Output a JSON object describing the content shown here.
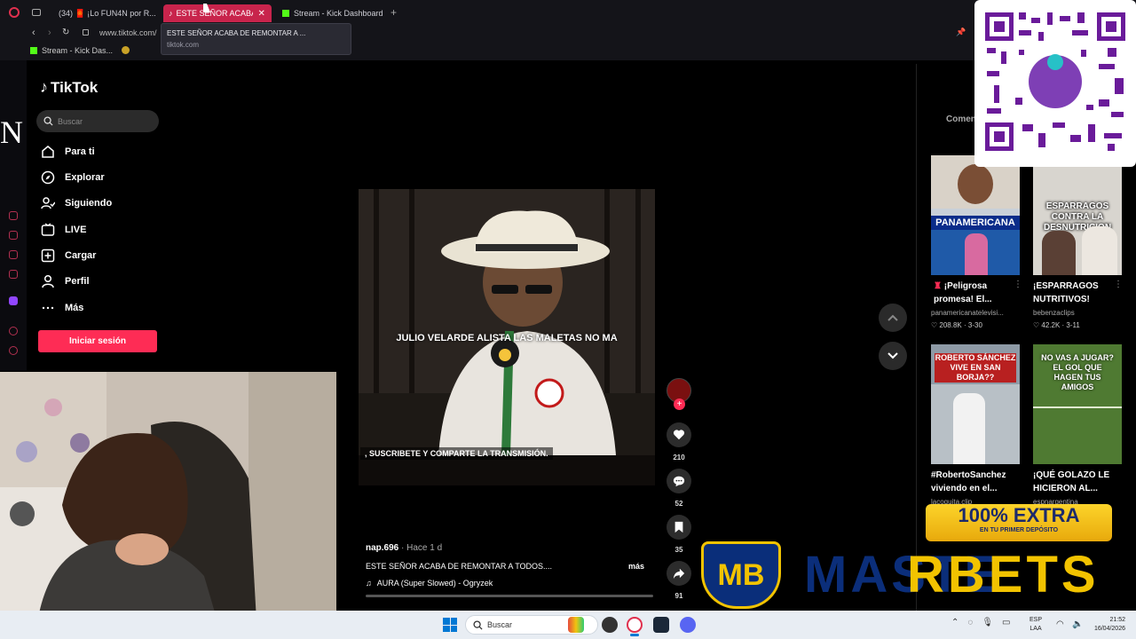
{
  "browser": {
    "tabs": [
      {
        "label": "(34) 🧧 ¡Lo FUN4N por R...",
        "active": false
      },
      {
        "label": "ESTE SEÑOR ACABA DE",
        "active": true
      },
      {
        "label": "Stream - Kick Dashboard",
        "active": false
      }
    ],
    "url": "www.tiktok.com/",
    "tooltip_title": "ESTE SEÑOR ACABA DE REMONTAR A ...",
    "tooltip_domain": "tiktok.com",
    "bookmark": "Stream - Kick Das..."
  },
  "tiktok": {
    "logo": "TikTok",
    "search_placeholder": "Buscar",
    "nav": [
      {
        "label": "Para ti",
        "icon": "home-icon"
      },
      {
        "label": "Explorar",
        "icon": "compass-icon"
      },
      {
        "label": "Siguiendo",
        "icon": "following-icon"
      },
      {
        "label": "LIVE",
        "icon": "live-icon"
      },
      {
        "label": "Cargar",
        "icon": "upload-icon"
      },
      {
        "label": "Perfil",
        "icon": "profile-icon"
      },
      {
        "label": "Más",
        "icon": "more-icon"
      }
    ],
    "login_button": "Iniciar sesión",
    "big_letter": "N"
  },
  "video": {
    "overlay_title": "JULIO VELARDE ALISTA LAS MALETAS NO MA",
    "caption_overlay": ", SUSCRIBETE Y COMPARTE LA TRANSMISIÓN.",
    "author": "nap.696",
    "time": "· Hace 1 d",
    "description": "ESTE SEÑOR ACABA DE REMONTAR A TODOS....",
    "more": "más",
    "music": "AURA (Super Slowed) - Ogryzek",
    "actions": {
      "likes": "210",
      "comments": "52",
      "saves": "35",
      "shares": "91"
    }
  },
  "sidebar_right": {
    "comments_tab": "Comen",
    "cards": [
      {
        "title": "¡Peligrosa promesa! El...",
        "author": "panamericanatelevisi...",
        "views": "208.8K",
        "date": "3-30"
      },
      {
        "title": "¡ESPARRAGOS NUTRITIVOS!",
        "author": "bebenzaclips",
        "views": "42.2K",
        "date": "3-11"
      },
      {
        "title": "#RobertoSanchez viviendo en el...",
        "author": "lacoquita.clip",
        "views": "",
        "date": ""
      },
      {
        "title": "¡QUÉ GOLAZO LE HICIERON AL...",
        "author": "espnargentina",
        "views": "",
        "date": ""
      }
    ],
    "thumb_texts": [
      "PANAMERICANA",
      "ESPARRAGOS CONTRA LA DESNUTRICION",
      "ROBERTO SÁNCHEZ VIVE EN SAN BORJA??",
      "NO VAS A JUGAR? EL GOL QUE HAGEN TUS AMIGOS"
    ]
  },
  "overlays": {
    "promo_line1": "100% EXTRA",
    "promo_line2": "EN TU PRIMER DEPÓSITO",
    "brand_left": "MASTE",
    "brand_right": "RBETS",
    "badge": "MB"
  },
  "taskbar": {
    "search": "Buscar",
    "lang1": "ESP",
    "lang2": "LAA",
    "time": "21:52",
    "date": "16/04/2026"
  },
  "colors": {
    "accent": "#fe2c55",
    "tab_active": "#c8244c",
    "chrome_bg": "#141419"
  }
}
